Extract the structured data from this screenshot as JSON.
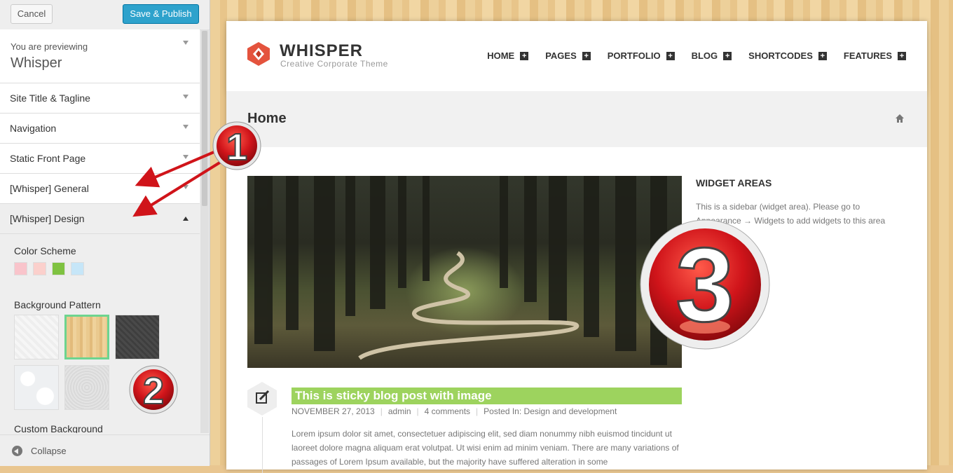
{
  "customizer": {
    "cancel_label": "Cancel",
    "publish_label": "Save & Publish",
    "previewing_label": "You are previewing",
    "theme_name": "Whisper",
    "sections": [
      {
        "title": "Site Title & Tagline"
      },
      {
        "title": "Navigation"
      },
      {
        "title": "Static Front Page"
      },
      {
        "title": "[Whisper] General"
      },
      {
        "title": "[Whisper] Design"
      }
    ],
    "design": {
      "color_scheme_label": "Color Scheme",
      "swatches": [
        "#f9c4cb",
        "#fbd0cc",
        "#7fc241",
        "#c6e6f8"
      ],
      "background_pattern_label": "Background Pattern",
      "patterns": [
        "white-texture",
        "wood",
        "dark-texture",
        "floral",
        "grey-texture"
      ],
      "selected_pattern": "wood",
      "custom_background_label": "Custom Background"
    },
    "collapse_label": "Collapse"
  },
  "site": {
    "name": "WHISPER",
    "tagline": "Creative  Corporate Theme",
    "nav": [
      "HOME",
      "PAGES",
      "PORTFOLIO",
      "BLOG",
      "SHORTCODES",
      "FEATURES"
    ],
    "nav_plus": "+",
    "page_title": "Home",
    "widget_title": "WIDGET AREAS",
    "widget_text": "This is a sidebar (widget area). Please go to Appearance → Widgets to add widgets to this area",
    "post": {
      "title": "This is sticky blog post with image",
      "date": "NOVEMBER 27, 2013",
      "author": "admin",
      "comments": "4 comments",
      "category": "Posted In: Design and development",
      "excerpt": "Lorem ipsum dolor sit amet, consectetuer adipiscing elit, sed diam nonummy nibh euismod tincidunt ut laoreet dolore magna aliquam erat volutpat. Ut wisi enim ad minim veniam. There are many variations of passages of Lorem Ipsum available, but the majority have suffered alteration in some"
    }
  },
  "annotations": {
    "badge_1": "1",
    "badge_2": "2",
    "badge_3": "3",
    "badge_color": "#d0141a"
  }
}
